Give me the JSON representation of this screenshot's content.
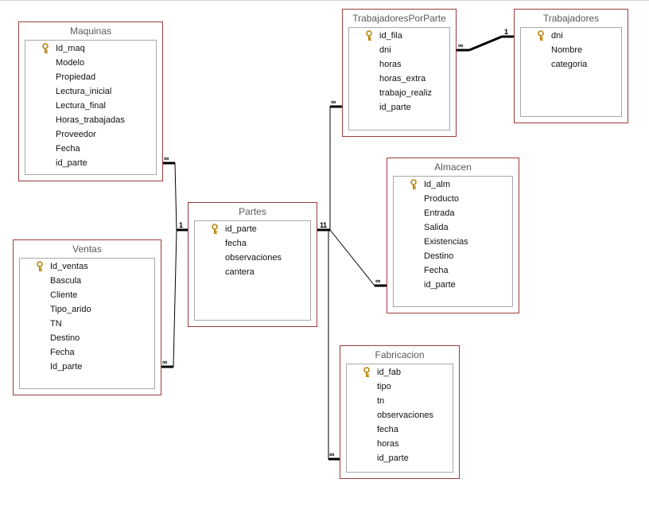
{
  "tables": [
    {
      "title": "Maquinas",
      "key_icon": "key-icon",
      "fields": [
        "Id_maq",
        "Modelo",
        "Propiedad",
        "Lectura_inicial",
        "Lectura_final",
        "Horas_trabajadas",
        "Proveedor",
        "Fecha",
        "id_parte"
      ]
    },
    {
      "title": "Ventas",
      "key_icon": "key-icon",
      "fields": [
        "Id_ventas",
        "Bascula",
        "Cliente",
        "Tipo_arido",
        "TN",
        "Destino",
        "Fecha",
        "Id_parte"
      ]
    },
    {
      "title": "Partes",
      "key_icon": "key-icon",
      "fields": [
        "id_parte",
        "fecha",
        "observaciones",
        "cantera"
      ]
    },
    {
      "title": "TrabajadoresPorParte",
      "key_icon": "key-icon",
      "fields": [
        "id_fila",
        "dni",
        "horas",
        "horas_extra",
        "trabajo_realiz",
        "id_parte"
      ]
    },
    {
      "title": "Trabajadores",
      "key_icon": "key-icon",
      "fields": [
        "dni",
        "Nombre",
        "categoria"
      ]
    },
    {
      "title": "Almacen",
      "key_icon": "key-icon",
      "fields": [
        "Id_alm",
        "Producto",
        "Entrada",
        "Salida",
        "Existencias",
        "Destino",
        "Fecha",
        "id_parte"
      ]
    },
    {
      "title": "Fabricacion",
      "key_icon": "key-icon",
      "fields": [
        "id_fab",
        "tipo",
        "tn",
        "observaciones",
        "fecha",
        "horas",
        "id_parte"
      ]
    }
  ],
  "relationships": [
    {
      "from": "Partes",
      "to": "Maquinas",
      "one": "1",
      "many": "∞"
    },
    {
      "from": "Partes",
      "to": "Ventas",
      "one": "1",
      "many": "∞"
    },
    {
      "from": "Partes",
      "to": "TrabajadoresPorParte",
      "one": "1",
      "many": "∞"
    },
    {
      "from": "Partes",
      "to": "Almacen",
      "one": "1",
      "many": "∞"
    },
    {
      "from": "Partes",
      "to": "Fabricacion",
      "one": "1",
      "many": "∞"
    },
    {
      "from": "Trabajadores",
      "to": "TrabajadoresPorParte",
      "one": "1",
      "many": "∞"
    }
  ]
}
